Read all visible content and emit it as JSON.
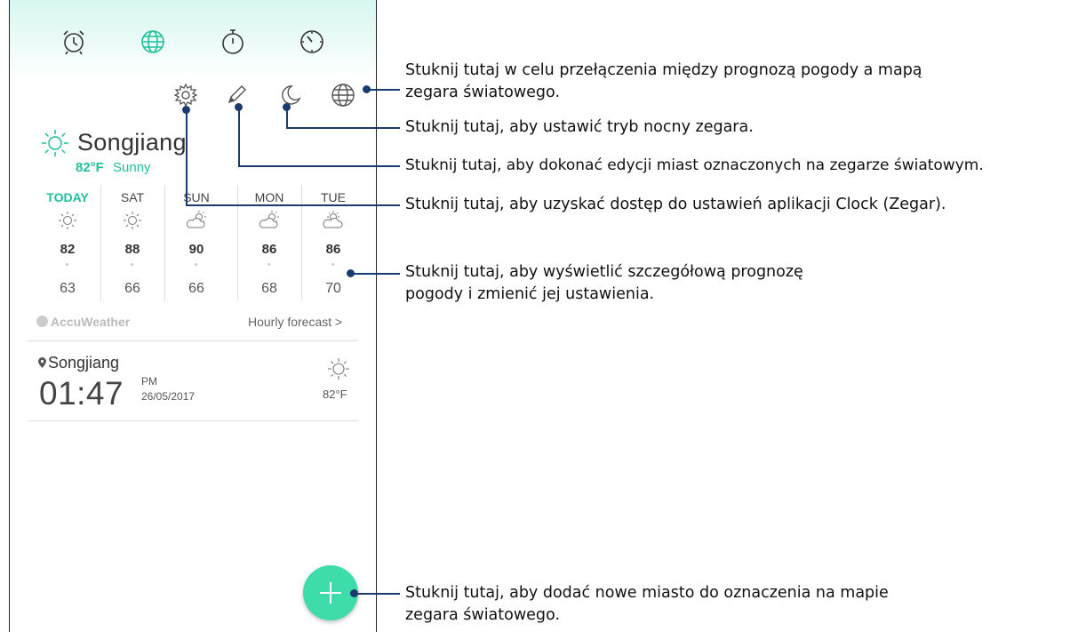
{
  "tabs": [
    {
      "name": "alarm-icon",
      "active": false
    },
    {
      "name": "globe-icon",
      "active": true
    },
    {
      "name": "stopwatch-icon",
      "active": false
    },
    {
      "name": "timer-icon",
      "active": false
    }
  ],
  "toolbar_icons": [
    "gear-icon",
    "pencil-icon",
    "moon-icon",
    "globe-icon"
  ],
  "weather": {
    "city": "Songjiang",
    "temp": "82°F",
    "condition": "Sunny",
    "days": [
      {
        "label": "TODAY",
        "icon": "sun-icon",
        "high": "82",
        "low": "63"
      },
      {
        "label": "SAT",
        "icon": "sun-icon",
        "high": "88",
        "low": "66"
      },
      {
        "label": "SUN",
        "icon": "partly-cloudy-icon",
        "high": "90",
        "low": "66"
      },
      {
        "label": "MON",
        "icon": "partly-cloudy-icon",
        "high": "86",
        "low": "68"
      },
      {
        "label": "TUE",
        "icon": "partly-cloudy-icon",
        "high": "86",
        "low": "70"
      }
    ],
    "provider": "AccuWeather",
    "hourly_link": "Hourly forecast >"
  },
  "world_clock": {
    "city": "Songjiang",
    "time": "01:47",
    "ampm": "PM",
    "date": "26/05/2017",
    "temp": "82°F"
  },
  "colors": {
    "accent": "#1fbf9a",
    "fab": "#3fdcab",
    "callout_line": "#1b3b6f"
  },
  "callouts": {
    "globe_1": "Stuknij tutaj w celu przełączenia między prognozą pogody a mapą",
    "globe_2": "zegara światowego.",
    "night": "Stuknij tutaj, aby ustawić tryb nocny zegara.",
    "edit": "Stuknij tutaj, aby dokonać edycji miast oznaczonych na zegarze światowym.",
    "settings": "Stuknij tutaj, aby uzyskać dostęp do ustawień aplikacji Clock (Zegar).",
    "forecast_1": "Stuknij tutaj, aby wyświetlić szczegółową prognozę",
    "forecast_2": "pogody i zmienić jej ustawienia.",
    "add_1": "Stuknij tutaj, aby dodać nowe miasto do oznaczenia na mapie",
    "add_2": "zegara światowego."
  }
}
